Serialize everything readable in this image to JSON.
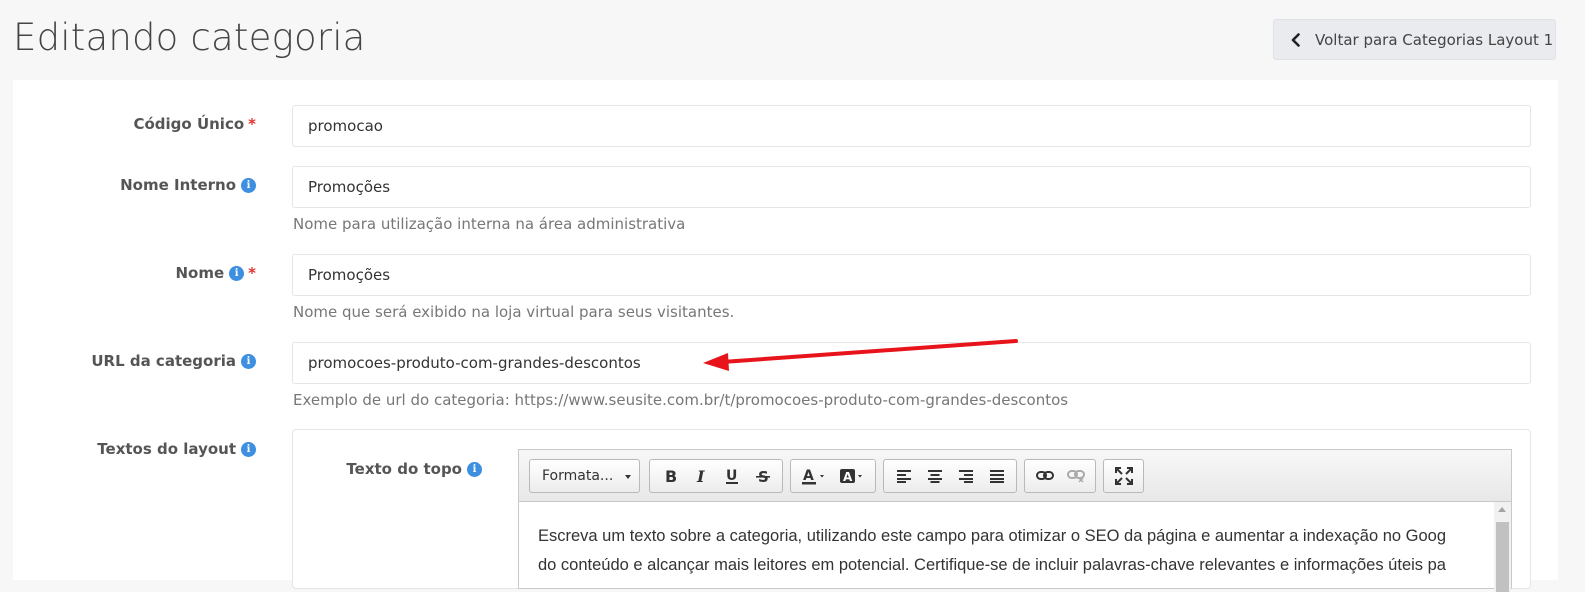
{
  "page": {
    "title": "Editando categoria",
    "back_label": "Voltar para Categorias Layout 1"
  },
  "form": {
    "codigo": {
      "label": "Código Único",
      "value": "promocao",
      "required": true
    },
    "nome_interno": {
      "label": "Nome Interno",
      "value": "Promoções",
      "help": "Nome para utilização interna na área administrativa"
    },
    "nome": {
      "label": "Nome",
      "value": "Promoções",
      "required": true,
      "help": "Nome que será exibido na loja virtual para seus visitantes."
    },
    "url": {
      "label": "URL da categoria",
      "value": "promocoes-produto-com-grandes-descontos",
      "help": "Exemplo de url do categoria: https://www.seusite.com.br/t/promocoes-produto-com-grandes-descontos"
    },
    "textos": {
      "label": "Textos do layout"
    },
    "texto_topo": {
      "label": "Texto do topo"
    }
  },
  "editor": {
    "format_label": "Formata...",
    "content_line1": "Escreva um texto sobre a categoria, utilizando este campo para otimizar o SEO da página e aumentar a indexação no Goog",
    "content_line2": "do conteúdo e alcançar mais leitores em potencial. Certifique-se de incluir palavras-chave relevantes e informações úteis pa"
  },
  "required_mark": "*",
  "info_glyph": "i",
  "colors": {
    "accent_info": "#3d8fe0",
    "required": "#e3342f",
    "annotation_arrow": "#e8141b"
  }
}
